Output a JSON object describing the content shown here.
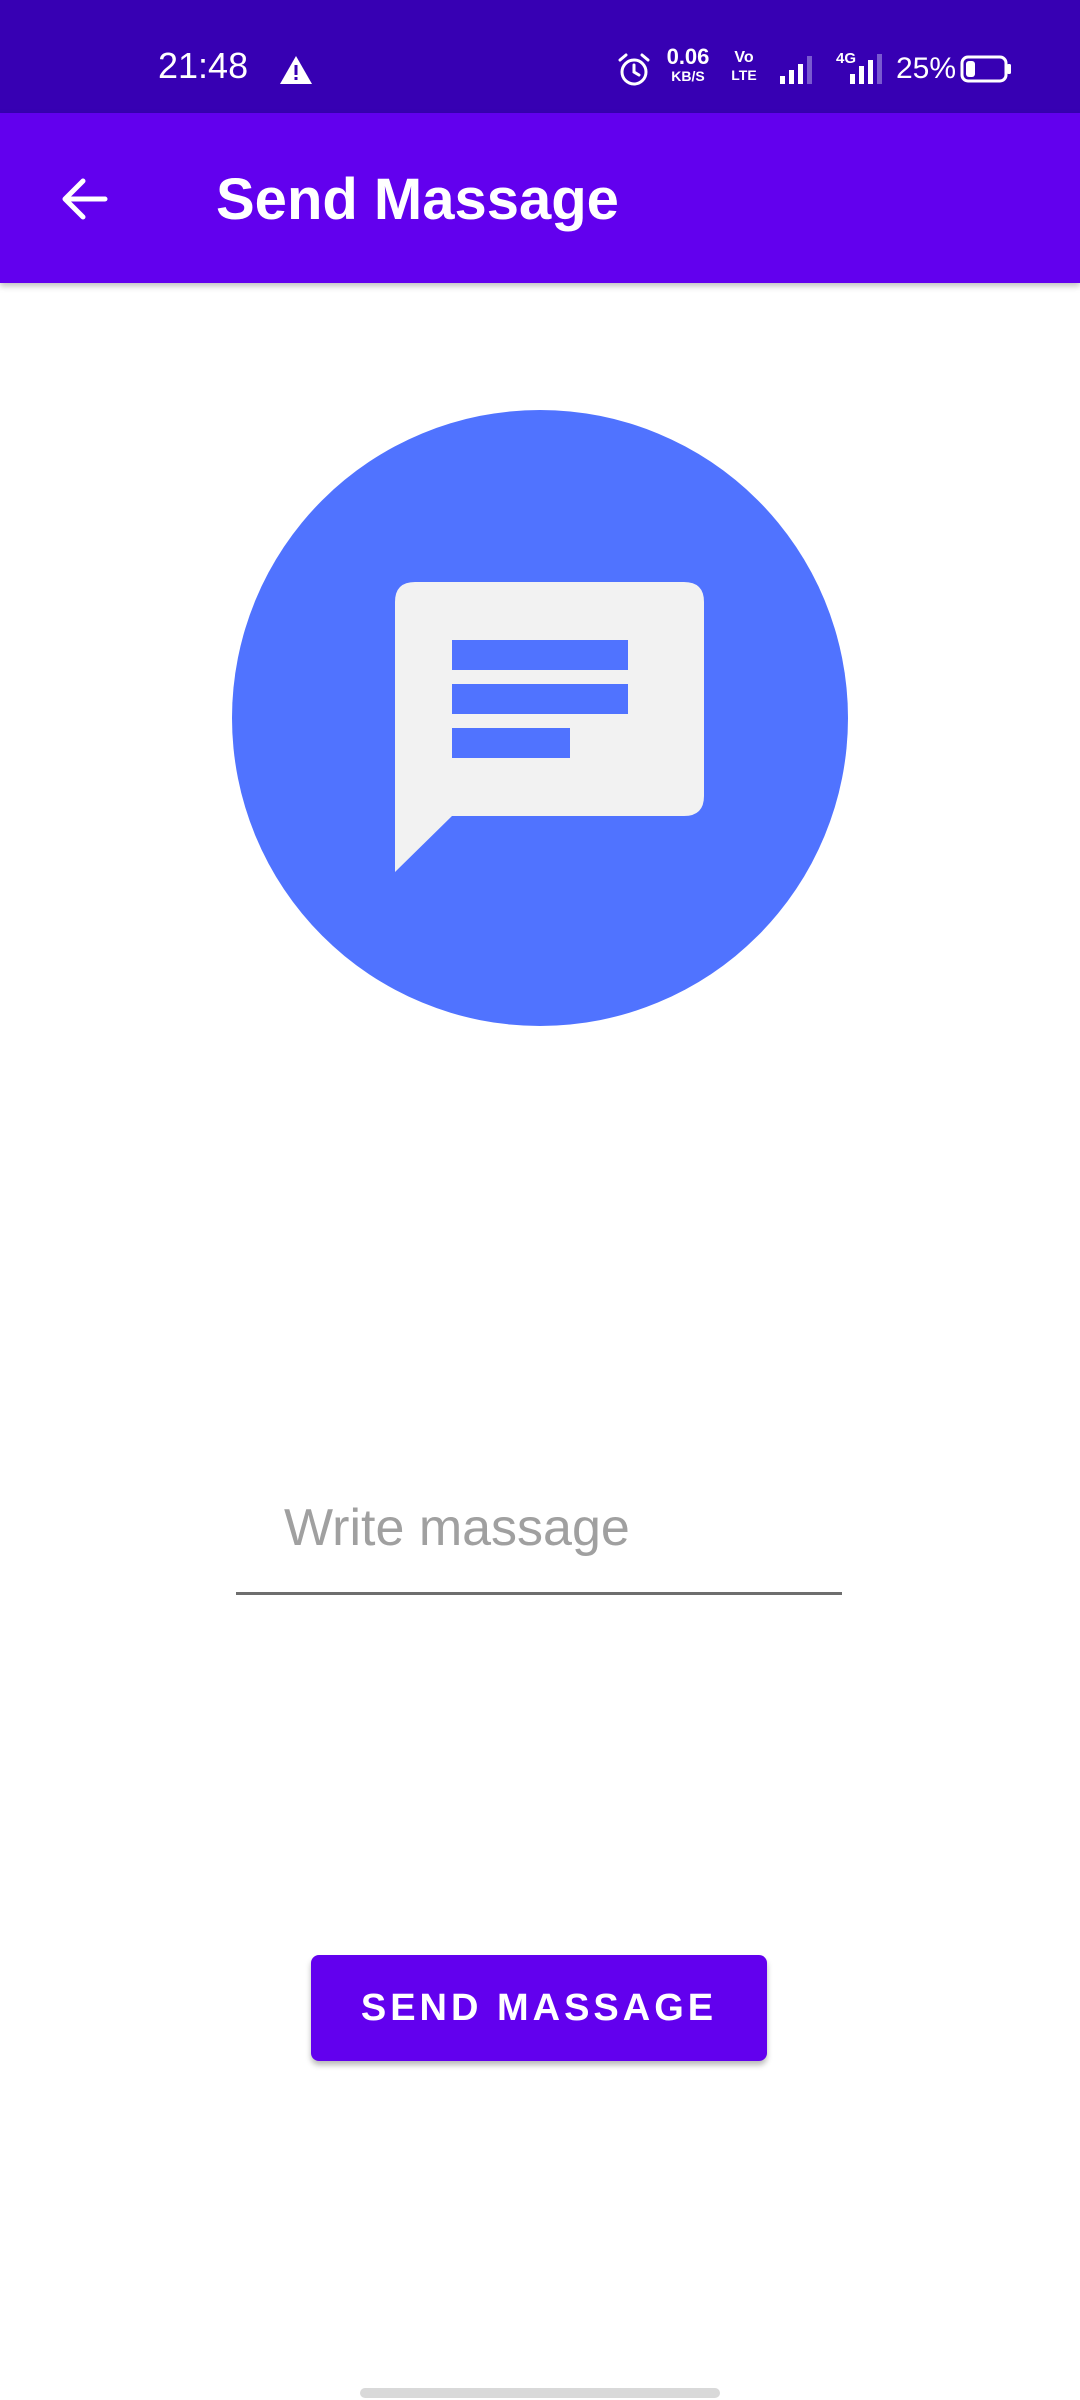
{
  "status_bar": {
    "time": "21:48",
    "net_speed_value": "0.06",
    "net_speed_unit": "KB/S",
    "volte_top": "Vo",
    "volte_bottom": "LTE",
    "network_type": "4G",
    "battery_percent": "25%",
    "battery_level": 0.25,
    "icons": [
      "warning-icon",
      "alarm-icon",
      "signal-icon",
      "signal-icon",
      "battery-icon"
    ]
  },
  "app_bar": {
    "back_icon": "arrow-back-icon",
    "title": "Send Massage"
  },
  "main": {
    "image_icon": "message-icon",
    "input_placeholder": "Write massage",
    "input_value": "",
    "send_button_label": "SEND MASSAGE"
  },
  "colors": {
    "status_bar": "#3700B3",
    "primary": "#6200EE",
    "icon_circle": "#5073FF",
    "bubble": "#F2F2F2"
  }
}
